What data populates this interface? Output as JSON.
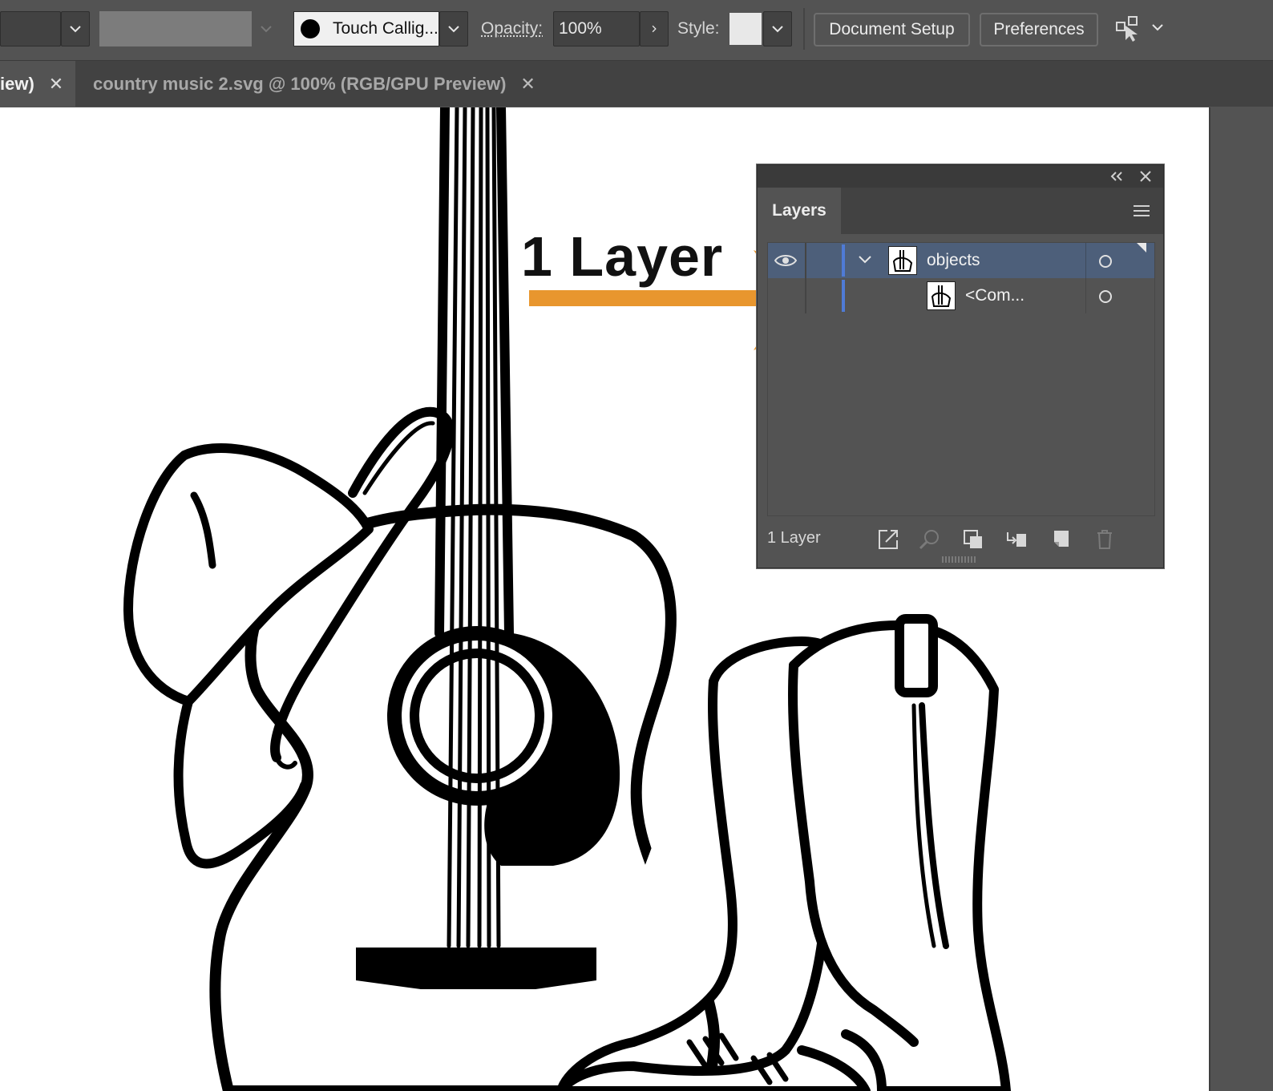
{
  "control_bar": {
    "brush_label": "Touch Callig...",
    "opacity_label": "Opacity:",
    "opacity_value": "100%",
    "style_label": "Style:",
    "document_setup_label": "Document Setup",
    "preferences_label": "Preferences",
    "arrange_icon": "arrange-documents-icon"
  },
  "tabs": [
    {
      "title": "iew)",
      "close": "✕",
      "active": true
    },
    {
      "title": "country music 2.svg @ 100% (RGB/GPU Preview)",
      "close": "✕",
      "active": false
    }
  ],
  "annotation": {
    "label": "1 Layer",
    "arrow_color": "#E8962E"
  },
  "layers_panel": {
    "tab_label": "Layers",
    "rows": [
      {
        "name": "objects",
        "visible": true,
        "expanded": true,
        "selected": true
      },
      {
        "name": "<Com...",
        "visible": false,
        "expanded": false,
        "selected": false
      }
    ],
    "footer_count": "1 Layer",
    "footer_icons": [
      "collect-for-export-icon",
      "locate-object-icon",
      "make-clipping-mask-icon",
      "create-sublayer-icon",
      "create-new-layer-icon",
      "delete-icon"
    ]
  },
  "colors": {
    "ui_bg": "#535353",
    "ui_dark": "#424242",
    "selection": "#4d5f7a",
    "layer_color": "#4f7bd6",
    "canvas": "#ffffff"
  }
}
